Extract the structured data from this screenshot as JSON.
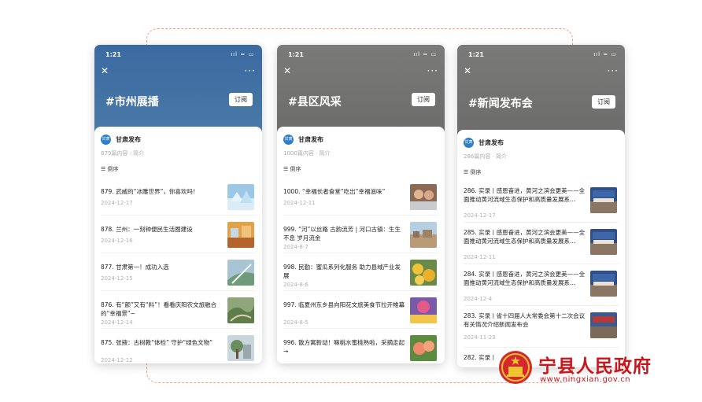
{
  "status_icons": "ııl ≈ ▭",
  "phones": [
    {
      "time": "1:21",
      "close": "✕",
      "more": "···",
      "topic": "#市州展播",
      "subscribe": "订阅",
      "source": "甘肃发布",
      "logo_text": "甘肃",
      "meta": "879篇内容 · 简介",
      "sort": "☰ 倒序",
      "items": [
        {
          "title": "879. 武威的“冰雕世界”，你喜欢吗！",
          "date": "2024-12-17"
        },
        {
          "title": "878. 兰州：一刻钟便民生活圈建设",
          "date": "2024-12-16"
        },
        {
          "title": "877. 甘肃第一！成功入选",
          "date": "2024-12-15"
        },
        {
          "title": "876. 有“颜”又有“料”！看看庆阳农文旅融合的“幸福景”~",
          "date": "2024-12-14"
        },
        {
          "title": "875. 张掖：古树教“体检” 守护“绿色文物”",
          "date": "2024-12-12"
        }
      ]
    },
    {
      "time": "1:21",
      "close": "✕",
      "more": "···",
      "topic": "#县区风采",
      "subscribe": "订阅",
      "source": "甘肃发布",
      "logo_text": "甘肃",
      "meta": "1000篇内容 · 简介",
      "sort": "☰ 倒序",
      "items": [
        {
          "title": "1000. “幸福长者食堂”吃出“幸福滋味”",
          "date": "2024-12-11"
        },
        {
          "title": "999. “河”以丝路 古韵流芳 | 河口古镇：生生不息 岁月流金",
          "date": "2024-8-7"
        },
        {
          "title": "998. 民勤：蜜瓜系列化服务 助力县域产业发展",
          "date": "2024-8-6"
        },
        {
          "title": "997. 临夏州东乡县向阳花文旅美食节拉开帷幕",
          "date": "2024-8-5"
        },
        {
          "title": "996. 散方寓新动！嘛桃水蜜桃熟啦，采摘走起→",
          "date": ""
        }
      ]
    },
    {
      "time": "1:21",
      "close": "✕",
      "more": "···",
      "topic": "#新闻发布会",
      "subscribe": "订阅",
      "source": "甘肃发布",
      "logo_text": "甘肃",
      "meta": "286篇内容 · 简介",
      "sort": "☰ 倒序",
      "items": [
        {
          "title": "286. 实录丨感恩奋进，黄河之滨会更美——全面推动黄河流域生态保护和高质量发展系…",
          "date": "2024-12-17"
        },
        {
          "title": "285. 实录丨感恩奋进，黄河之滨会更美——全面推动黄河流域生态保护和高质量发展系…",
          "date": "2024-12-11"
        },
        {
          "title": "284. 实录丨感恩奋进，黄河之滨会更美——全面推动黄河流域生态保护和高质量发展系…",
          "date": "2024-12-4"
        },
        {
          "title": "283. 实录丨省十四届人大常委会第十二次会议有关情况介绍新闻发布会",
          "date": "2024-11-29"
        },
        {
          "title": "282. 实录丨",
          "date": ""
        }
      ]
    }
  ],
  "watermark": {
    "title": "宁县人民政府",
    "url": "www.ningxian.gov.cn"
  },
  "colors": {
    "hero_blue": "#3a6aa0",
    "hero_gray": "#747472",
    "brand_red": "#c8161d",
    "frame_dash": "#f0a07a"
  }
}
